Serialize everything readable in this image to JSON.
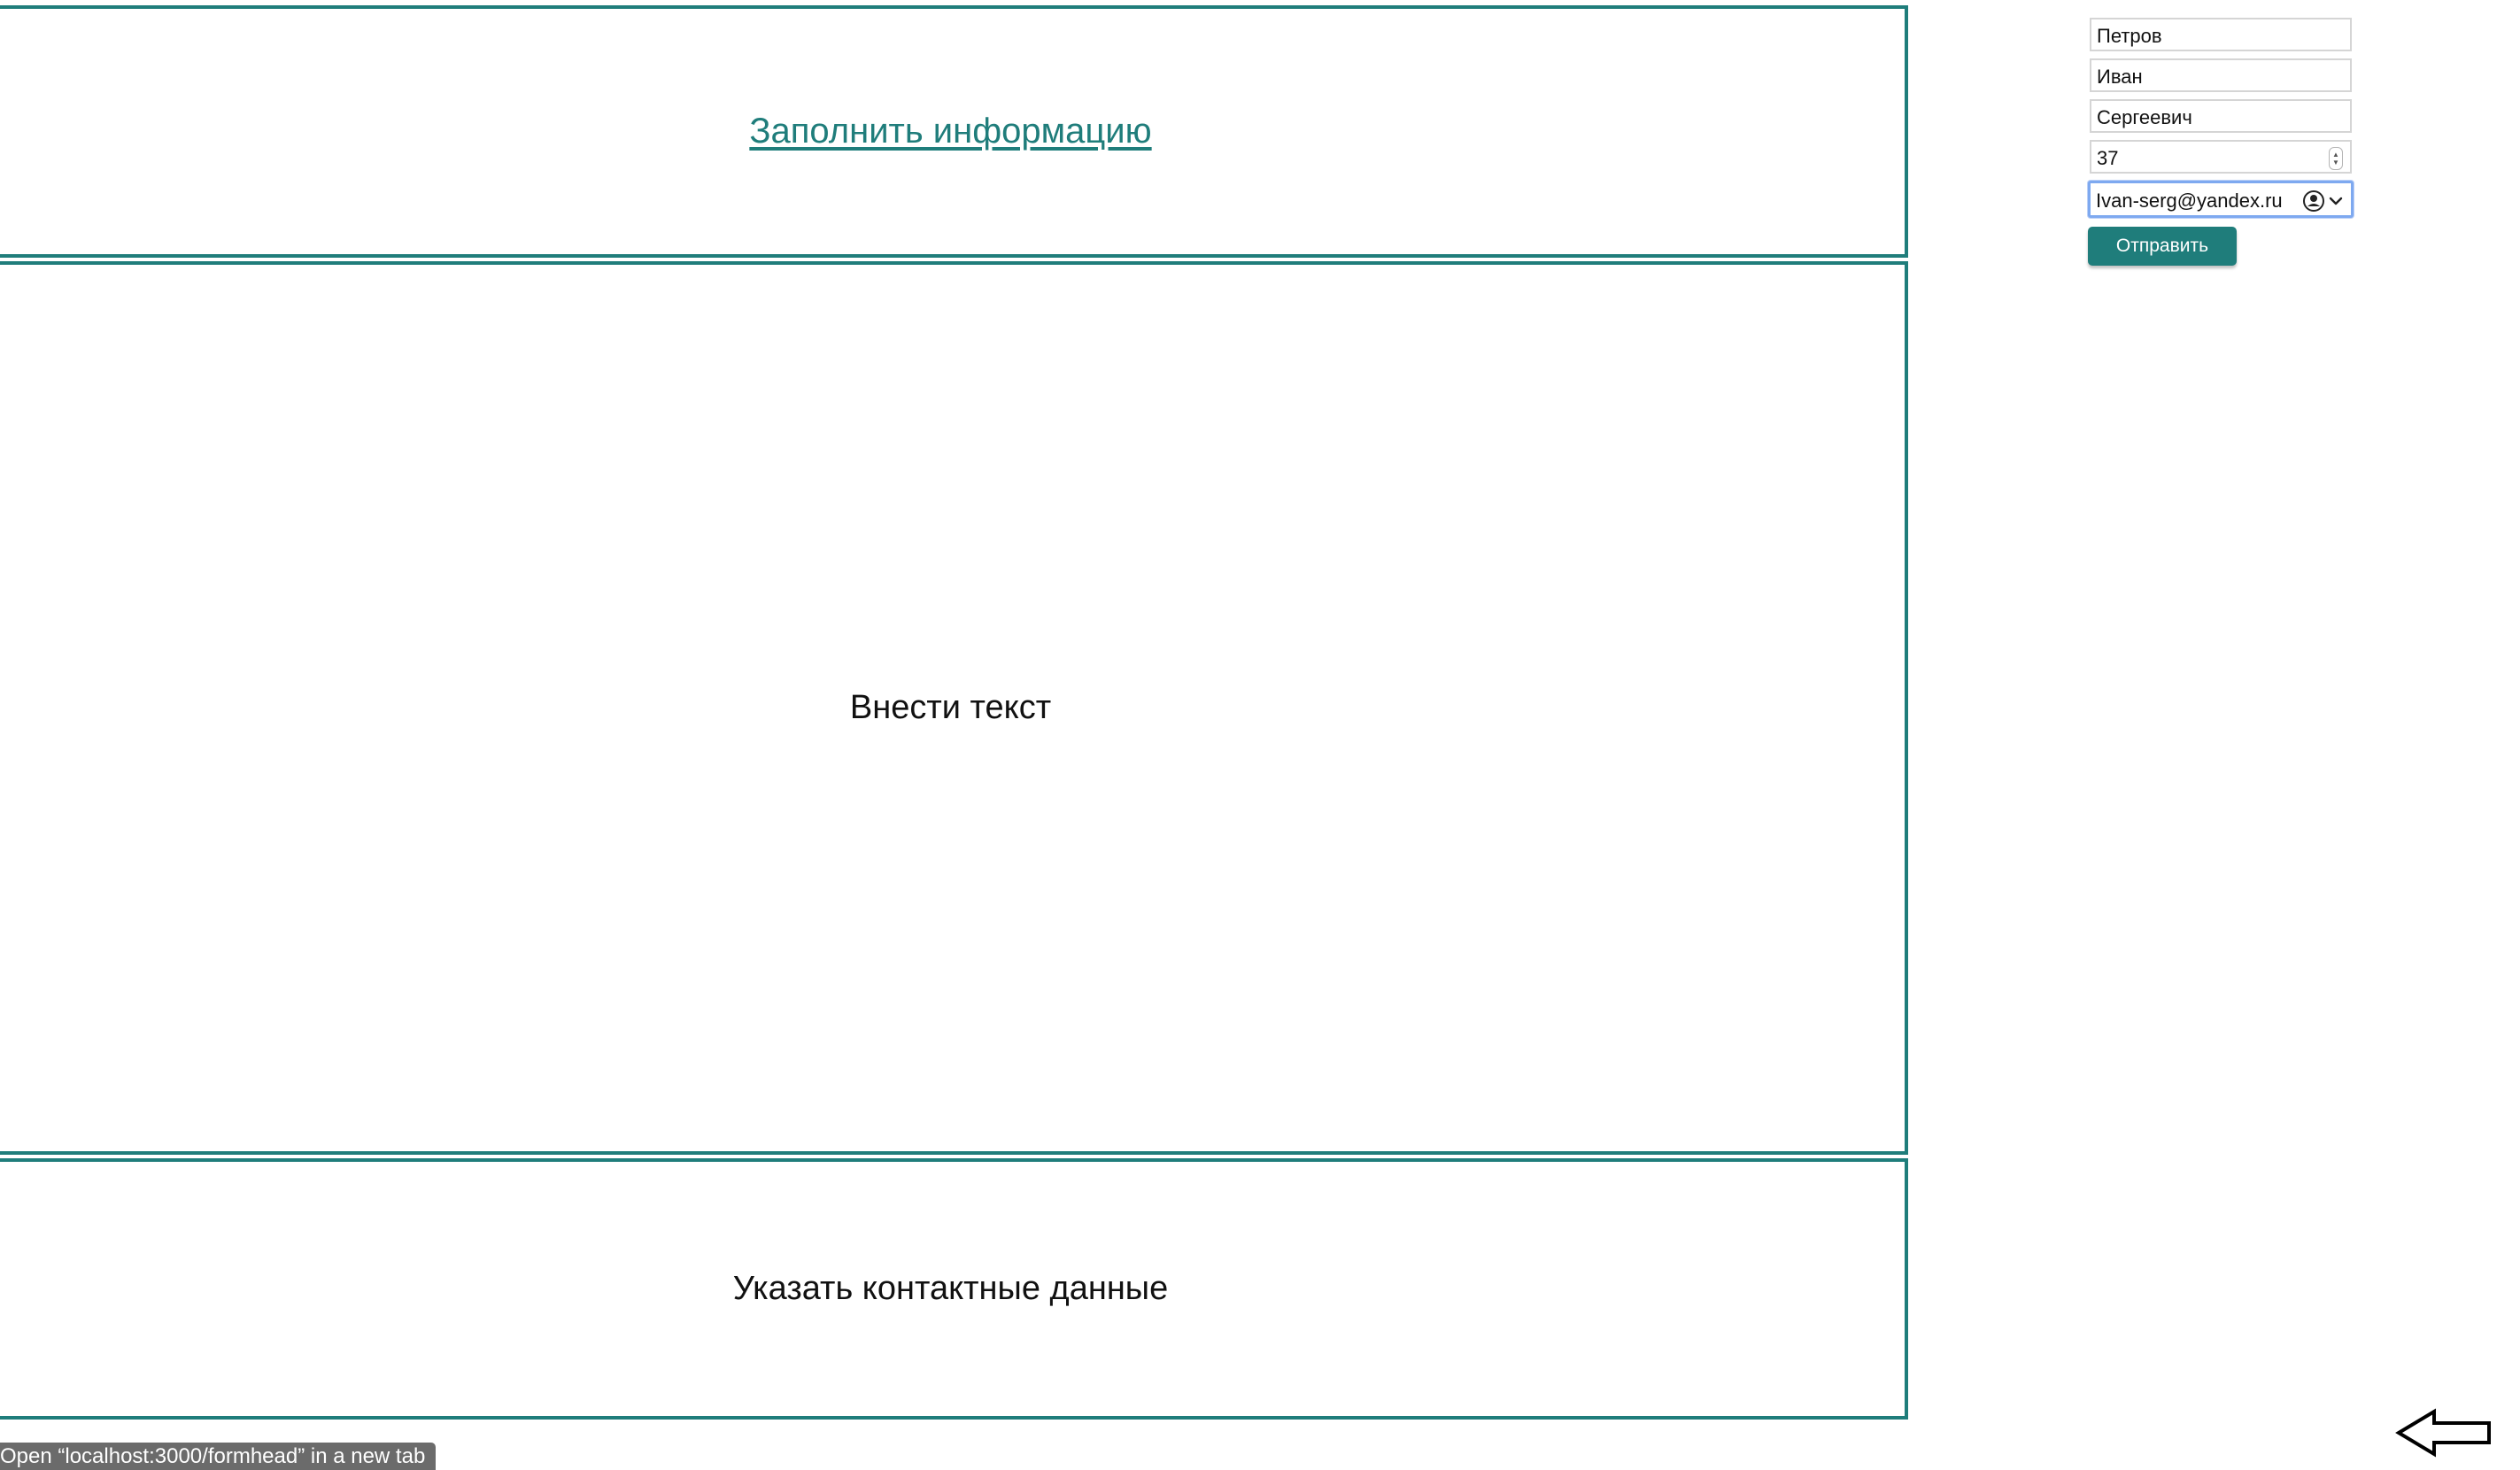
{
  "panels": {
    "top_link": "Заполнить информацию",
    "middle_text": "Внести текст",
    "bottom_text": "Указать контактные данные"
  },
  "form": {
    "last_name": "Петров",
    "first_name": "Иван",
    "middle_name": "Сергеевич",
    "age": "37",
    "email": "Ivan-serg@yandex.ru",
    "submit_label": "Отправить"
  },
  "status_bar": {
    "text": "Open “localhost:3000/formhead” in a new tab"
  },
  "colors": {
    "accent": "#1f7d7b",
    "focus_ring": "#7ea9f0"
  },
  "icons": [
    "autofill-contact-icon",
    "chevron-down-icon",
    "stepper-icon",
    "back-arrow-icon"
  ]
}
